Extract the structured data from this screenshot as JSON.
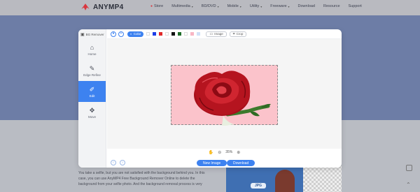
{
  "brand": {
    "name": "ANYMP4",
    "accent": "#d9363e"
  },
  "nav": {
    "items": [
      {
        "label": "Store",
        "has_dot": true,
        "has_chevron": false
      },
      {
        "label": "Multimedia",
        "has_dot": false,
        "has_chevron": true
      },
      {
        "label": "BD/DVD",
        "has_dot": false,
        "has_chevron": true
      },
      {
        "label": "Mobile",
        "has_dot": false,
        "has_chevron": true
      },
      {
        "label": "Utility",
        "has_dot": false,
        "has_chevron": true
      },
      {
        "label": "Freeware",
        "has_dot": false,
        "has_chevron": true
      },
      {
        "label": "Download",
        "has_dot": false,
        "has_chevron": false
      },
      {
        "label": "Resource",
        "has_dot": false,
        "has_chevron": false
      },
      {
        "label": "Support",
        "has_dot": false,
        "has_chevron": false
      }
    ]
  },
  "modal": {
    "title": "BG Remover",
    "sidebar": [
      {
        "label": "Home",
        "icon": "home-icon",
        "active": false
      },
      {
        "label": "Edge Refine",
        "icon": "edit-pencil-icon",
        "active": false
      },
      {
        "label": "Edit",
        "icon": "image-edit-icon",
        "active": true
      },
      {
        "label": "Move",
        "icon": "move-arrows-icon",
        "active": false
      }
    ],
    "toolbar": {
      "color_label": "Color",
      "swatches": [
        "#ffffff",
        "#1d3ee8",
        "#e02a2a",
        "#ffffff",
        "#111111",
        "#1f6e2a",
        "#ffffff",
        "#f7b6c4",
        "#cfe0f7"
      ],
      "image_label": "Image",
      "crop_label": "Crop"
    },
    "zoom": {
      "value": "35%"
    },
    "new_image_label": "New Image",
    "download_label": "Download",
    "accent": "#3d82f0",
    "canvas_bg": "#fbc3cb"
  },
  "page": {
    "body_text": "You take a selfie, but you are not satisfied with the background behind you. In this case, you can use AnyMP4 Free Background Remover Online to delete the background from your selfie photo. And the background removal process is very",
    "badge": "JPG"
  }
}
